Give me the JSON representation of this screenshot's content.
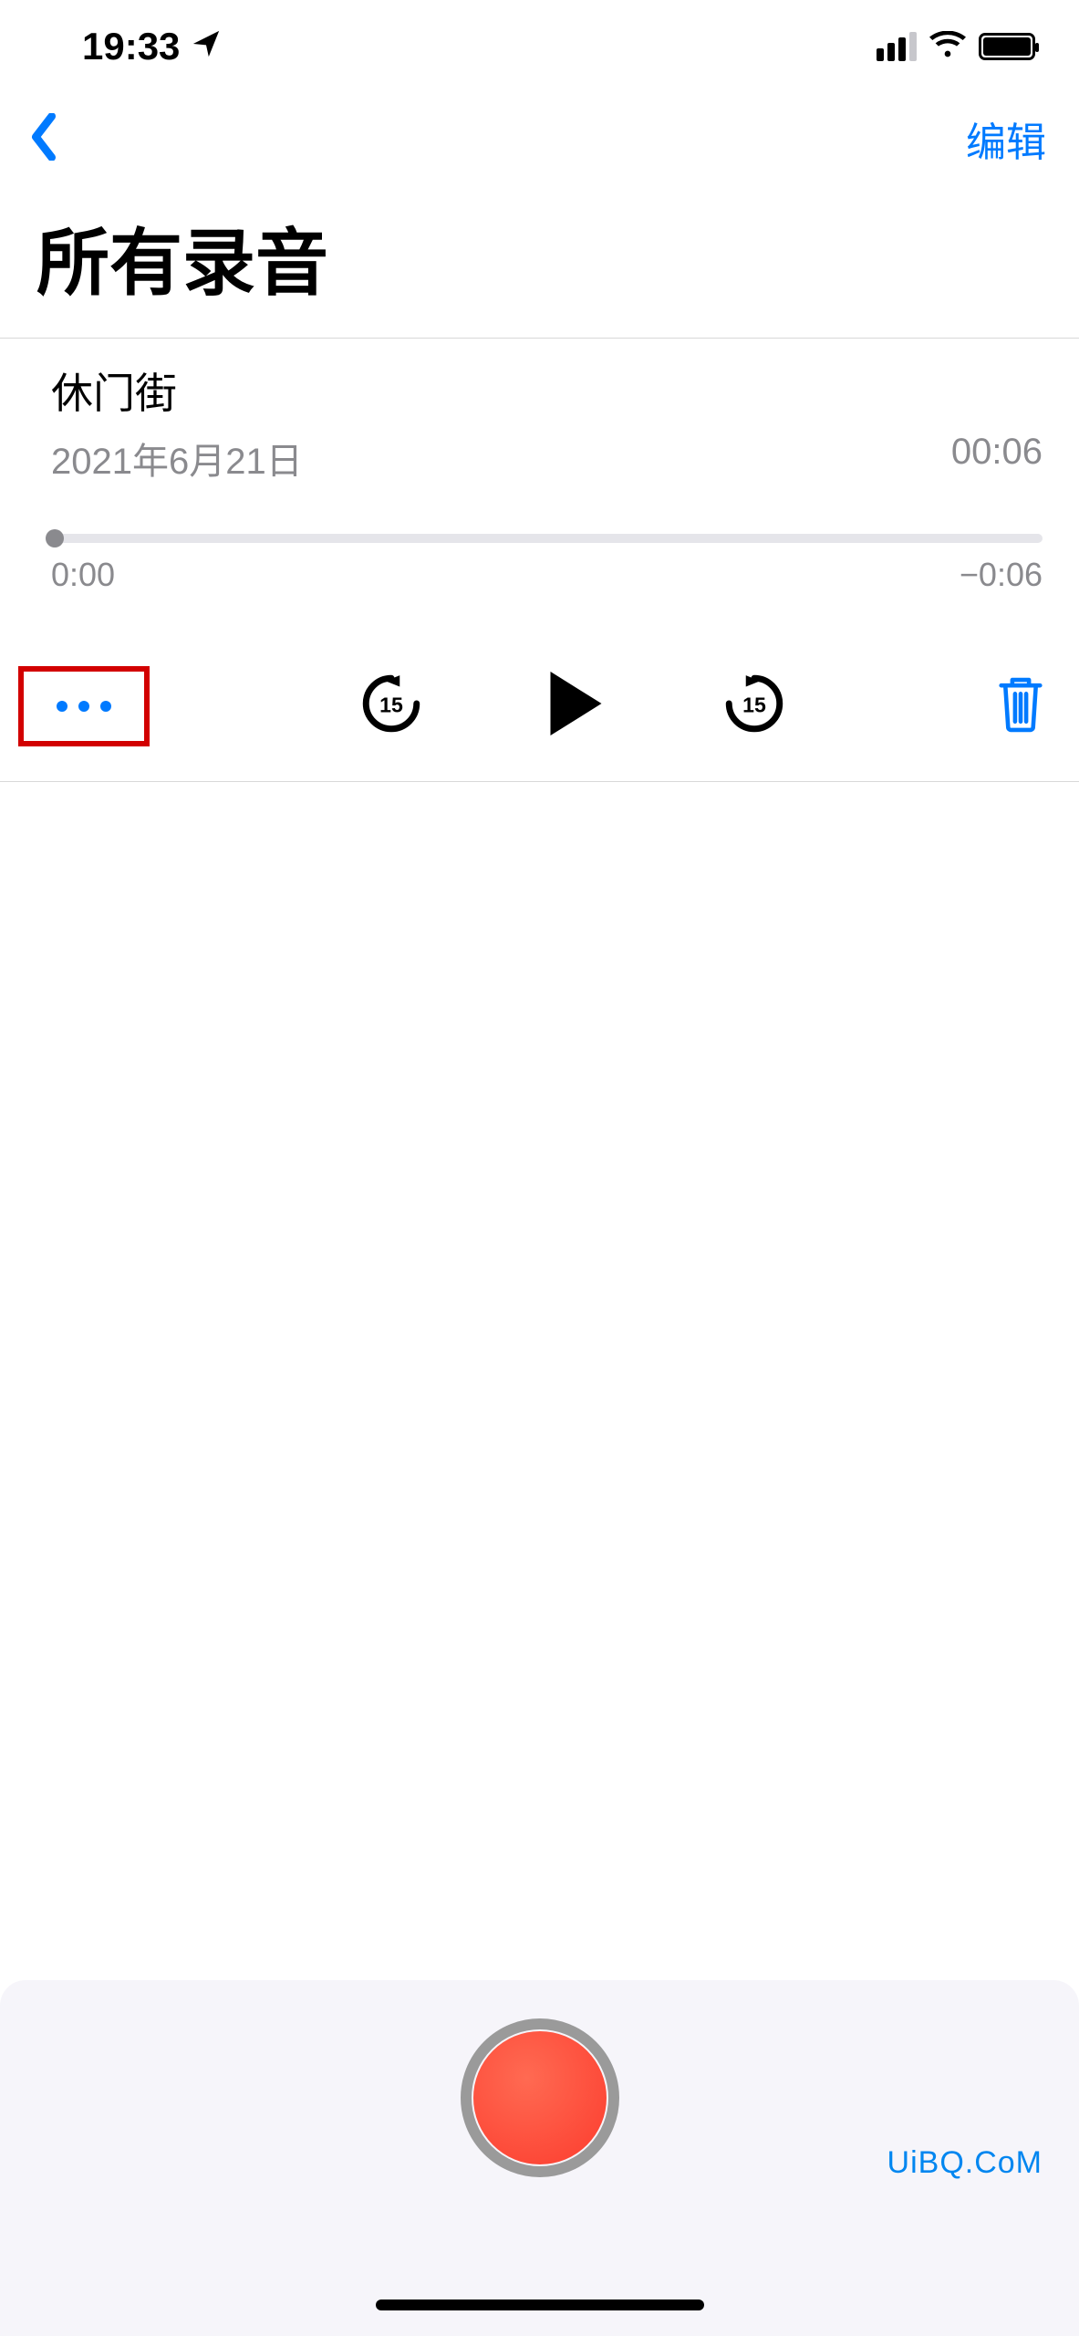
{
  "status": {
    "time": "19:33"
  },
  "nav": {
    "edit_label": "编辑"
  },
  "page": {
    "title": "所有录音"
  },
  "recording": {
    "name": "休门街",
    "date": "2021年6月21日",
    "duration": "00:06",
    "elapsed": "0:00",
    "remaining": "−0:06",
    "skip_seconds": "15"
  },
  "watermark": "UiBQ.CoM"
}
